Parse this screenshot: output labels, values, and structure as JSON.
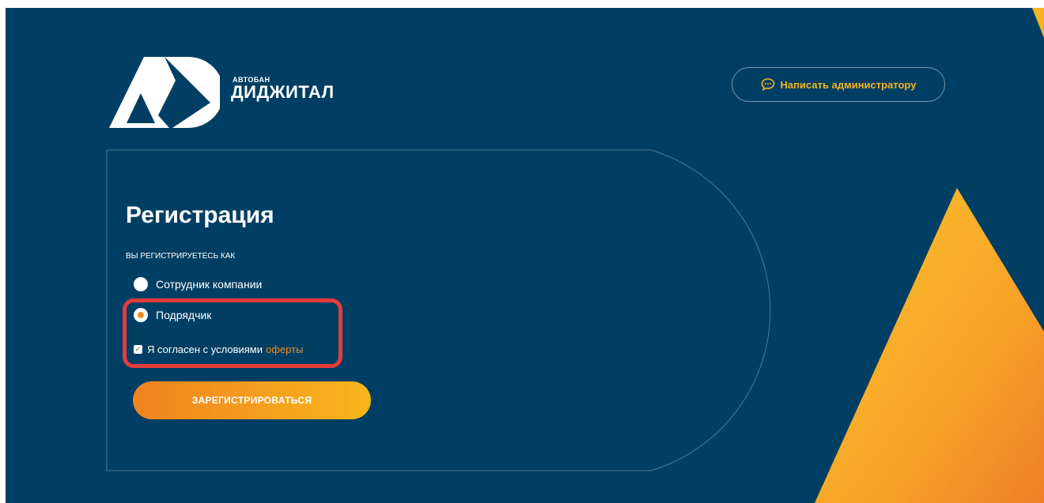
{
  "brand": {
    "name_small": "АВТОБАН",
    "name_big": "ДИДЖИТАЛ"
  },
  "header": {
    "contact_label": "Написать администратору"
  },
  "form": {
    "title": "Регистрация",
    "subtitle": "ВЫ РЕГИСТРИРУЕТЕСЬ КАК",
    "options": [
      {
        "label": "Сотрудник компании",
        "selected": false
      },
      {
        "label": "Подрядчик",
        "selected": true
      }
    ],
    "agree_text": "Я согласен с условиями",
    "agree_link": "оферты",
    "agree_checked": true,
    "submit_label": "ЗАРЕГИСТРИРОВАТЬСЯ"
  },
  "colors": {
    "background": "#003f63",
    "accent_orange": "#f08a24",
    "accent_yellow": "#f7b321",
    "highlight_red": "#e63c3c"
  }
}
